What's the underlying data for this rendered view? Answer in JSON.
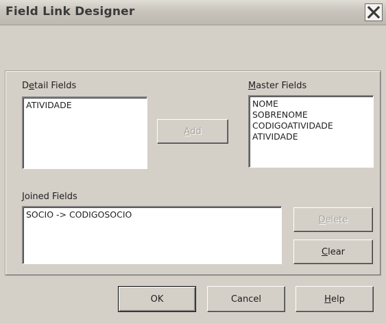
{
  "window": {
    "title": "Field Link Designer"
  },
  "detail": {
    "label_pre": "D",
    "label_acc": "e",
    "label_post": "tail Fields",
    "items": [
      "ATIVIDADE"
    ]
  },
  "master": {
    "label_acc": "M",
    "label_post": "aster Fields",
    "items": [
      "NOME",
      "SOBRENOME",
      "CODIGOATIVIDADE",
      "ATIVIDADE"
    ]
  },
  "add_button": {
    "acc": "A",
    "rest": "dd",
    "enabled": false
  },
  "joined": {
    "label_acc": "J",
    "label_post": "oined Fields",
    "items": [
      "SOCIO -> CODIGOSOCIO"
    ]
  },
  "delete_button": {
    "acc": "D",
    "rest": "elete",
    "enabled": false
  },
  "clear_button": {
    "acc": "C",
    "rest": "lear",
    "enabled": true
  },
  "footer": {
    "ok_label": "OK",
    "cancel_label": "Cancel",
    "help_acc": "H",
    "help_rest": "elp"
  }
}
